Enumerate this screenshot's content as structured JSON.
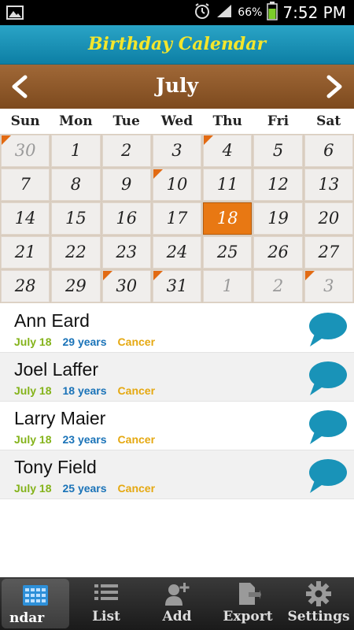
{
  "status_bar": {
    "battery_percent": "66%",
    "time": "7:52 PM",
    "icons": [
      "image-icon",
      "alarm-icon",
      "signal-icon",
      "battery-icon"
    ]
  },
  "header": {
    "title": "Birthday Calendar"
  },
  "calendar": {
    "month": "July",
    "weekdays": [
      "Sun",
      "Mon",
      "Tue",
      "Wed",
      "Thu",
      "Fri",
      "Sat"
    ],
    "weeks": [
      [
        {
          "d": "30",
          "other": true,
          "flag": true
        },
        {
          "d": "1"
        },
        {
          "d": "2"
        },
        {
          "d": "3"
        },
        {
          "d": "4",
          "flag": true
        },
        {
          "d": "5"
        },
        {
          "d": "6"
        }
      ],
      [
        {
          "d": "7"
        },
        {
          "d": "8"
        },
        {
          "d": "9"
        },
        {
          "d": "10",
          "flag": true
        },
        {
          "d": "11"
        },
        {
          "d": "12"
        },
        {
          "d": "13"
        }
      ],
      [
        {
          "d": "14"
        },
        {
          "d": "15"
        },
        {
          "d": "16"
        },
        {
          "d": "17"
        },
        {
          "d": "18",
          "today": true
        },
        {
          "d": "19"
        },
        {
          "d": "20"
        }
      ],
      [
        {
          "d": "21"
        },
        {
          "d": "22"
        },
        {
          "d": "23"
        },
        {
          "d": "24"
        },
        {
          "d": "25"
        },
        {
          "d": "26"
        },
        {
          "d": "27"
        }
      ],
      [
        {
          "d": "28"
        },
        {
          "d": "29"
        },
        {
          "d": "30",
          "flag": true
        },
        {
          "d": "31",
          "flag": true
        },
        {
          "d": "1",
          "other": true
        },
        {
          "d": "2",
          "other": true
        },
        {
          "d": "3",
          "other": true,
          "flag": true
        }
      ]
    ],
    "colors": {
      "today": "#e87813",
      "flag": "#e26a12",
      "header_bar": "#8f5a2a",
      "title_text": "#f4e62c"
    }
  },
  "birthdays": [
    {
      "name": "Ann Eard",
      "date": "July 18",
      "age": "29 years",
      "sign": "Cancer"
    },
    {
      "name": "Joel Laffer",
      "date": "July 18",
      "age": "18 years",
      "sign": "Cancer"
    },
    {
      "name": "Larry Maier",
      "date": "July 18",
      "age": "23 years",
      "sign": "Cancer"
    },
    {
      "name": "Tony Field",
      "date": "July 18",
      "age": "25 years",
      "sign": "Cancer"
    }
  ],
  "tabs": [
    {
      "label": "ndar",
      "icon": "calendar-grid-icon",
      "active": true
    },
    {
      "label": "List",
      "icon": "list-icon"
    },
    {
      "label": "Add",
      "icon": "add-person-icon"
    },
    {
      "label": "Export",
      "icon": "export-icon"
    },
    {
      "label": "Settings",
      "icon": "gear-icon"
    }
  ]
}
